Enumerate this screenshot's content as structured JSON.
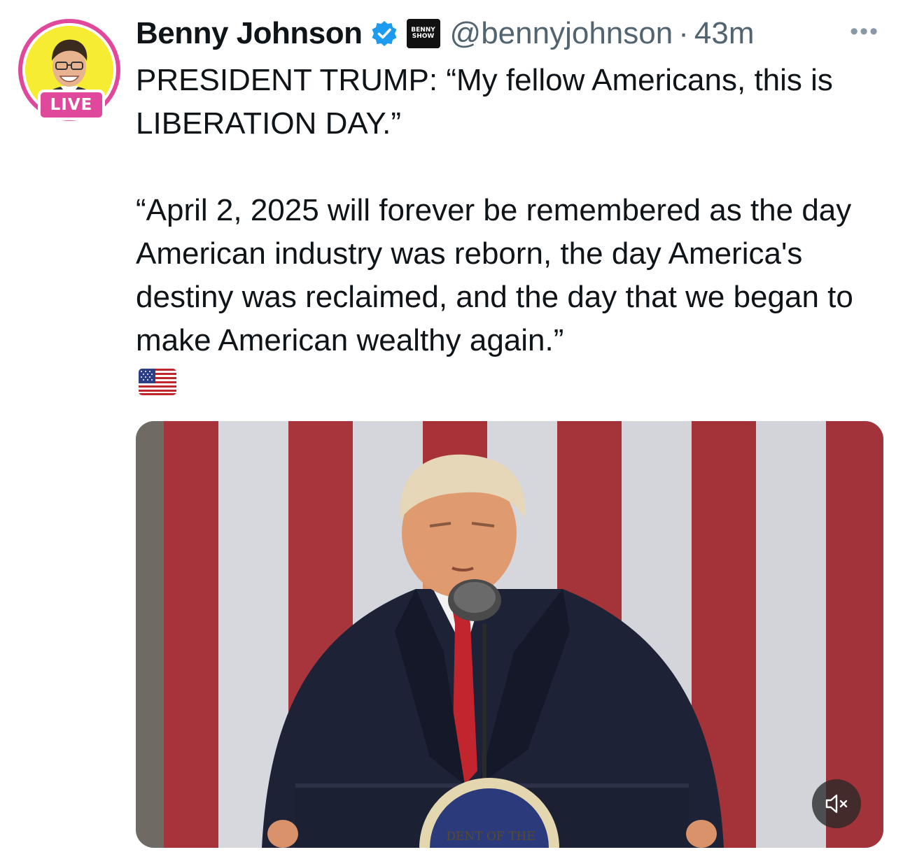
{
  "author": {
    "display_name": "Benny Johnson",
    "handle": "@bennyjohnson",
    "separator": "·",
    "timestamp": "43m",
    "live_badge": "LIVE",
    "affiliate_badge_lines": [
      "BENNY",
      "SHOW"
    ],
    "verified": true
  },
  "tweet": {
    "text": "PRESIDENT TRUMP: “My fellow Americans, this is LIBERATION DAY.”\n\n“April 2, 2025 will forever be remembered as the day American industry was reborn, the day America's destiny was reclaimed, and the day that we began to make American wealthy again.”",
    "emoji_icon": "us-flag-emoji"
  },
  "media": {
    "type": "video",
    "seal_text": "DENT OF THE",
    "muted": true
  },
  "colors": {
    "live_pink": "#e0489b",
    "verified_blue": "#1d9bf0",
    "secondary_text": "#536471",
    "avatar_yellow": "#f6ec31"
  },
  "icons": {
    "more": "more-options-icon",
    "mute": "mute-icon"
  }
}
